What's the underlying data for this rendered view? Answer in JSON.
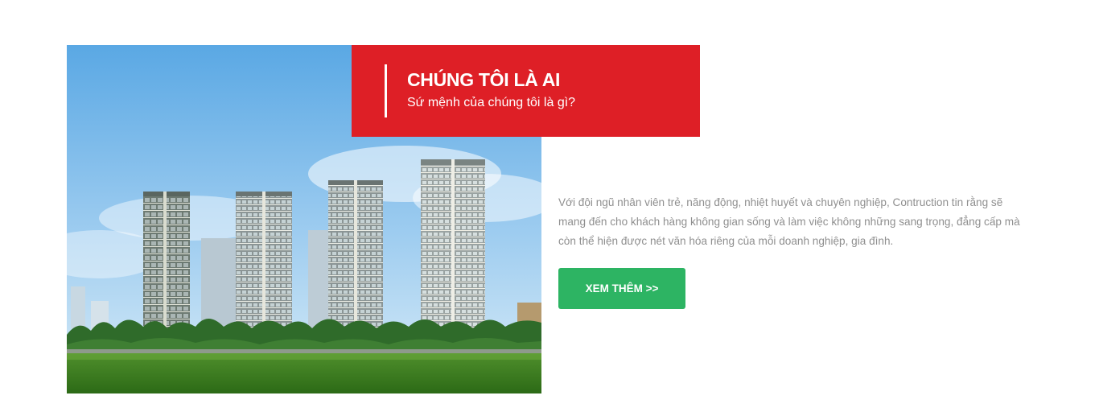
{
  "about": {
    "title": "CHÚNG TÔI LÀ AI",
    "subtitle": "Sứ mệnh của chúng tôi là gì?",
    "description": "Với đội ngũ nhân viên trẻ, năng động, nhiệt huyết và chuyên nghiệp, Contruction tin rằng sẽ mang đến cho khách hàng không gian sống và làm việc không những sang trọng, đẳng cấp mà còn thể hiện được nét văn hóa riêng của mỗi doanh nghiệp, gia đình.",
    "button_label": "XEM THÊM >>"
  },
  "colors": {
    "title_background": "#de1f26",
    "button_background": "#2db463",
    "body_text": "#8f8f8f"
  }
}
